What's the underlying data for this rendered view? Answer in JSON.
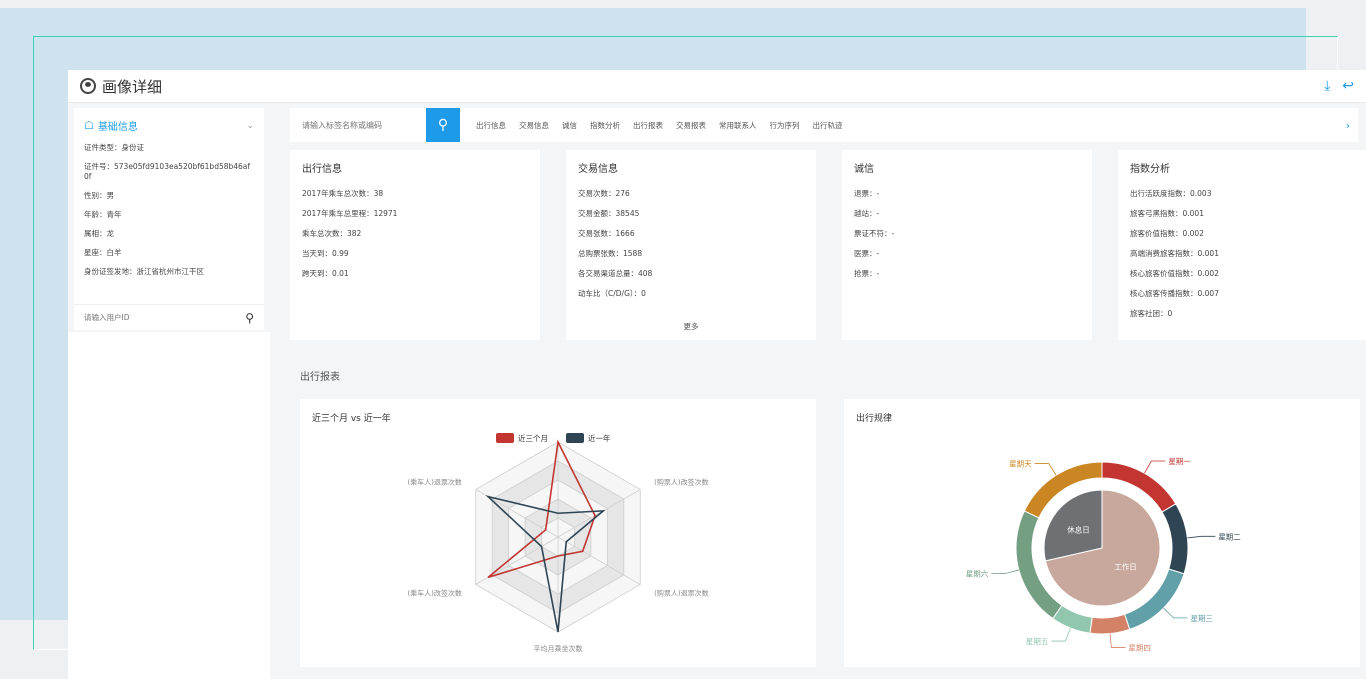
{
  "window": {
    "title": "画像详细",
    "actions": [
      "download-icon",
      "back-icon"
    ]
  },
  "left_panel": {
    "header": "基础信息",
    "fields": [
      "证件类型：身份证",
      "证件号：573e05fd9103ea520bf61bd58b46af0f",
      "性别：男",
      "年龄：青年",
      "属相：龙",
      "星座：白羊",
      "身份证签发地：浙江省杭州市江干区"
    ],
    "search_placeholder": "请输入用户ID"
  },
  "navbar": {
    "search_placeholder": "请输入标签名称或编码",
    "tabs": [
      "出行信息",
      "交易信息",
      "诚信",
      "指数分析",
      "出行报表",
      "交易报表",
      "常用联系人",
      "行为序列",
      "出行轨迹"
    ]
  },
  "cards": {
    "travel": {
      "title": "出行信息",
      "rows": [
        "2017年乘车总次数：38",
        "2017年乘车总里程：12971",
        "乘车总次数：382",
        "当天到：0.99",
        "跨天到：0.01"
      ]
    },
    "trade": {
      "title": "交易信息",
      "rows": [
        "交易次数：276",
        "交易金额：38545",
        "交易张数：1666",
        "总购票张数：1588",
        "各交易渠道总量：408",
        "动车比（C/D/G）：0"
      ],
      "more": "更多"
    },
    "credit": {
      "title": "诚信",
      "rows": [
        "退票：-",
        "越站：-",
        "票证不符：-",
        "医票：-",
        "抢票：-"
      ]
    },
    "index": {
      "title": "指数分析",
      "rows": [
        "出行活跃度指数：0.003",
        "旅客弓黑指数：0.001",
        "旅客价值指数：0.002",
        "高端消费旅客指数：0.001",
        "核心旅客价值指数：0.002",
        "核心旅客传播指数：0.007",
        "旅客社团：0"
      ]
    }
  },
  "report_section_title": "出行报表",
  "radar": {
    "title": "近三个月 vs 近一年",
    "legend": [
      "近三个月",
      "近一年"
    ],
    "indicators": [
      "",
      "(购票人)改签次数",
      "(购票人)退票次数",
      "平均月乘坐次数",
      "(乘车人)改签次数",
      "(乘车人)退票次数"
    ],
    "colors": {
      "recent3": "#c23531",
      "year": "#2f4554"
    }
  },
  "donut": {
    "title": "出行规律",
    "inner_labels": [
      "休息日",
      "工作日"
    ],
    "outer_labels": [
      "星期一",
      "星期二",
      "星期三",
      "星期四",
      "星期五",
      "星期六",
      "星期天"
    ],
    "colors": {
      "inner_rest": "#6e7074",
      "inner_work": "#c8a89d",
      "mon": "#c23531",
      "tue": "#2f4554",
      "wed": "#61a0a8",
      "thu": "#d48265",
      "fri": "#91c7ae",
      "sat": "#749f83",
      "sun": "#ca8622"
    }
  },
  "chart_data": [
    {
      "type": "radar",
      "title": "近三个月 vs 近一年",
      "indicators": [
        "",
        "(购票人)改签次数",
        "(购票人)退票次数",
        "平均月乘坐次数",
        "(乘车人)改签次数",
        "(乘车人)退票次数"
      ],
      "series": [
        {
          "name": "近三个月",
          "values": [
            1.0,
            0.45,
            0.3,
            0.2,
            0.85,
            0.15
          ]
        },
        {
          "name": "近一年",
          "values": [
            0.25,
            0.55,
            0.1,
            1.0,
            0.2,
            0.85
          ]
        }
      ]
    },
    {
      "type": "pie",
      "title": "出行规律",
      "inner": {
        "categories": [
          "工作日",
          "休息日"
        ],
        "values": [
          5,
          2
        ]
      },
      "outer": {
        "categories": [
          "星期一",
          "星期二",
          "星期三",
          "星期四",
          "星期五",
          "星期六",
          "星期天"
        ],
        "values": [
          11,
          9,
          10,
          5,
          5,
          15,
          12
        ]
      }
    }
  ]
}
